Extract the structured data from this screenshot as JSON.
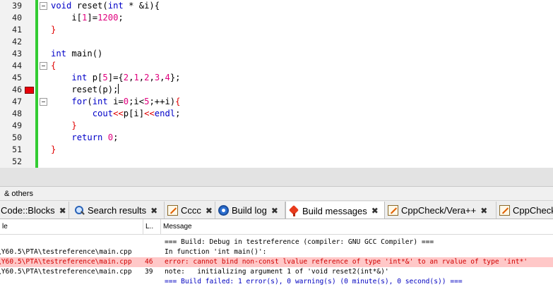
{
  "editor": {
    "lines": [
      {
        "n": "39",
        "tokens": [
          {
            "t": "void",
            "c": "kw"
          },
          {
            "t": " reset(",
            "c": ""
          },
          {
            "t": "int",
            "c": "kw"
          },
          {
            "t": " * &i){",
            "c": ""
          }
        ],
        "fold": true
      },
      {
        "n": "40",
        "tokens": [
          {
            "t": "    i[",
            "c": ""
          },
          {
            "t": "1",
            "c": "num"
          },
          {
            "t": "]=",
            "c": ""
          },
          {
            "t": "1200",
            "c": "num"
          },
          {
            "t": ";",
            "c": ""
          }
        ]
      },
      {
        "n": "41",
        "tokens": [
          {
            "t": "}",
            "c": "br"
          }
        ]
      },
      {
        "n": "42",
        "tokens": []
      },
      {
        "n": "43",
        "tokens": [
          {
            "t": "int",
            "c": "kw"
          },
          {
            "t": " main()",
            "c": ""
          }
        ]
      },
      {
        "n": "44",
        "tokens": [
          {
            "t": "{",
            "c": "br"
          }
        ],
        "fold": true
      },
      {
        "n": "45",
        "tokens": [
          {
            "t": "    ",
            "c": ""
          },
          {
            "t": "int",
            "c": "kw"
          },
          {
            "t": " p[",
            "c": ""
          },
          {
            "t": "5",
            "c": "num"
          },
          {
            "t": "]={",
            "c": ""
          },
          {
            "t": "2",
            "c": "num"
          },
          {
            "t": ",",
            "c": ""
          },
          {
            "t": "1",
            "c": "num"
          },
          {
            "t": ",",
            "c": ""
          },
          {
            "t": "2",
            "c": "num"
          },
          {
            "t": ",",
            "c": ""
          },
          {
            "t": "3",
            "c": "num"
          },
          {
            "t": ",",
            "c": ""
          },
          {
            "t": "4",
            "c": "num"
          },
          {
            "t": "};",
            "c": ""
          }
        ]
      },
      {
        "n": "46",
        "tokens": [
          {
            "t": "    reset(p);",
            "c": ""
          }
        ],
        "error": true,
        "cursor": true
      },
      {
        "n": "47",
        "tokens": [
          {
            "t": "    ",
            "c": ""
          },
          {
            "t": "for",
            "c": "kw"
          },
          {
            "t": "(",
            "c": ""
          },
          {
            "t": "int",
            "c": "kw"
          },
          {
            "t": " i=",
            "c": ""
          },
          {
            "t": "0",
            "c": "num"
          },
          {
            "t": ";i<",
            "c": ""
          },
          {
            "t": "5",
            "c": "num"
          },
          {
            "t": ";++i)",
            "c": ""
          },
          {
            "t": "{",
            "c": "br"
          }
        ],
        "fold": true
      },
      {
        "n": "48",
        "tokens": [
          {
            "t": "        ",
            "c": ""
          },
          {
            "t": "cout",
            "c": "kw"
          },
          {
            "t": "<<",
            "c": "op"
          },
          {
            "t": "p[i]",
            "c": ""
          },
          {
            "t": "<<",
            "c": "op"
          },
          {
            "t": "endl",
            "c": "kw"
          },
          {
            "t": ";",
            "c": ""
          }
        ]
      },
      {
        "n": "49",
        "tokens": [
          {
            "t": "    }",
            "c": "br"
          }
        ]
      },
      {
        "n": "50",
        "tokens": [
          {
            "t": "    ",
            "c": ""
          },
          {
            "t": "return",
            "c": "kw"
          },
          {
            "t": " ",
            "c": ""
          },
          {
            "t": "0",
            "c": "num"
          },
          {
            "t": ";",
            "c": ""
          }
        ]
      },
      {
        "n": "51",
        "tokens": [
          {
            "t": "}",
            "c": "br"
          }
        ]
      },
      {
        "n": "52",
        "tokens": []
      }
    ]
  },
  "logs": {
    "title": "& others",
    "tabs": [
      {
        "label": "Code::Blocks",
        "icon": "none",
        "name": "tab-codeblocks"
      },
      {
        "label": "Search results",
        "icon": "search-icon",
        "name": "tab-search-results"
      },
      {
        "label": "Cccc",
        "icon": "document-icon",
        "name": "tab-cccc"
      },
      {
        "label": "Build log",
        "icon": "gear-icon",
        "name": "tab-build-log"
      },
      {
        "label": "Build messages",
        "icon": "diamond-icon",
        "name": "tab-build-messages",
        "active": true
      },
      {
        "label": "CppCheck/Vera++",
        "icon": "document-icon",
        "name": "tab-cppcheck-vera"
      },
      {
        "label": "CppCheck/",
        "icon": "document-icon",
        "name": "tab-cppcheck"
      }
    ],
    "columns": {
      "file": "le",
      "line": "L..",
      "message": "Message"
    },
    "rows": [
      {
        "file": "",
        "line": "",
        "message": "=== Build: Debug in testreference (compiler: GNU GCC Compiler) ===",
        "kind": "normal"
      },
      {
        "file": "\\Y60.5\\PTA\\testreference\\main.cpp",
        "line": "",
        "message": "In function 'int main()':",
        "kind": "normal"
      },
      {
        "file": "\\Y60.5\\PTA\\testreference\\main.cpp",
        "line": "46",
        "message": "error: cannot bind non-const lvalue reference of type 'int*&' to an rvalue of type 'int*'",
        "kind": "err"
      },
      {
        "file": "\\Y60.5\\PTA\\testreference\\main.cpp",
        "line": "39",
        "message": "note:   initializing argument 1 of 'void reset2(int*&)'",
        "kind": "normal"
      },
      {
        "file": "",
        "line": "",
        "message": "=== Build failed: 1 error(s), 0 warning(s) (0 minute(s), 0 second(s)) ===",
        "kind": "blue"
      }
    ]
  }
}
